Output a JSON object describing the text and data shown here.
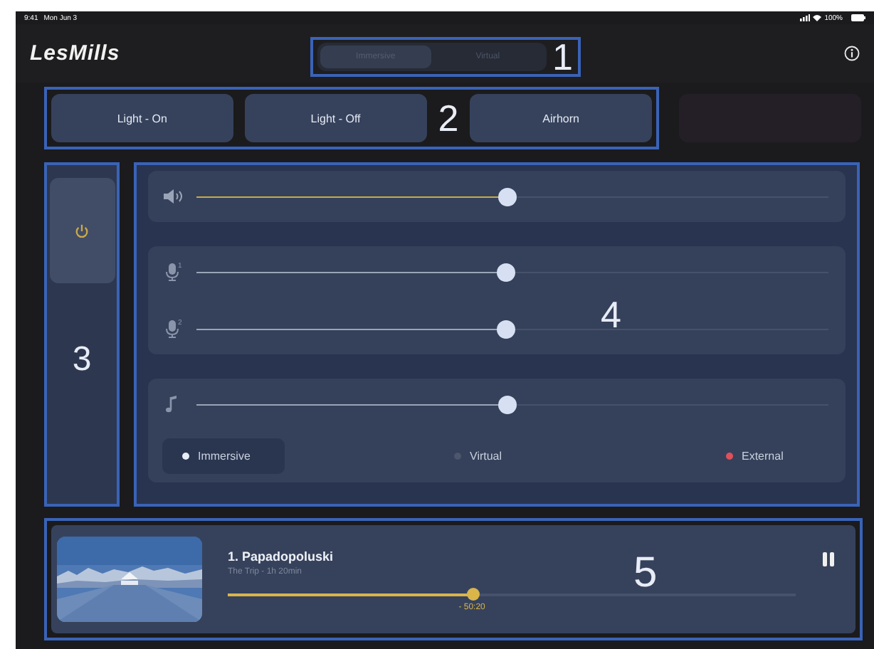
{
  "status_bar": {
    "time": "9:41",
    "date": "Mon Jun 3",
    "battery": "100%"
  },
  "header": {
    "logo": "LesMills",
    "annotation": "1",
    "mode_switch": [
      {
        "label": "Immersive",
        "selected": true
      },
      {
        "label": "Virtual",
        "selected": false
      }
    ]
  },
  "quick_actions": {
    "annotation": "2",
    "buttons": [
      {
        "label": "Light - On"
      },
      {
        "label": "Light - Off"
      },
      {
        "label": "Airhorn"
      }
    ]
  },
  "power_panel": {
    "annotation": "3",
    "on": true
  },
  "mixer": {
    "annotation": "4",
    "groups": [
      {
        "channels": [
          {
            "kind": "volume",
            "level": 0.49
          }
        ]
      },
      {
        "channels": [
          {
            "kind": "mic",
            "number": "1",
            "level": 0.49
          },
          {
            "kind": "mic",
            "number": "2",
            "level": 0.49
          }
        ]
      },
      {
        "channels": [
          {
            "kind": "music",
            "level": 0.49
          }
        ],
        "sources": [
          {
            "label": "Immersive",
            "selected": true,
            "color": "#e8ecf4"
          },
          {
            "label": "Virtual",
            "selected": false,
            "color": "#4c566c"
          },
          {
            "label": "External",
            "selected": false,
            "color": "#e0505a"
          }
        ]
      }
    ]
  },
  "now_playing": {
    "annotation": "5",
    "title": "1. Papadopoluski",
    "subtitle": "The Trip - 1h 20min",
    "level": 0.43,
    "remaining": "- 50:20",
    "playing": true
  }
}
